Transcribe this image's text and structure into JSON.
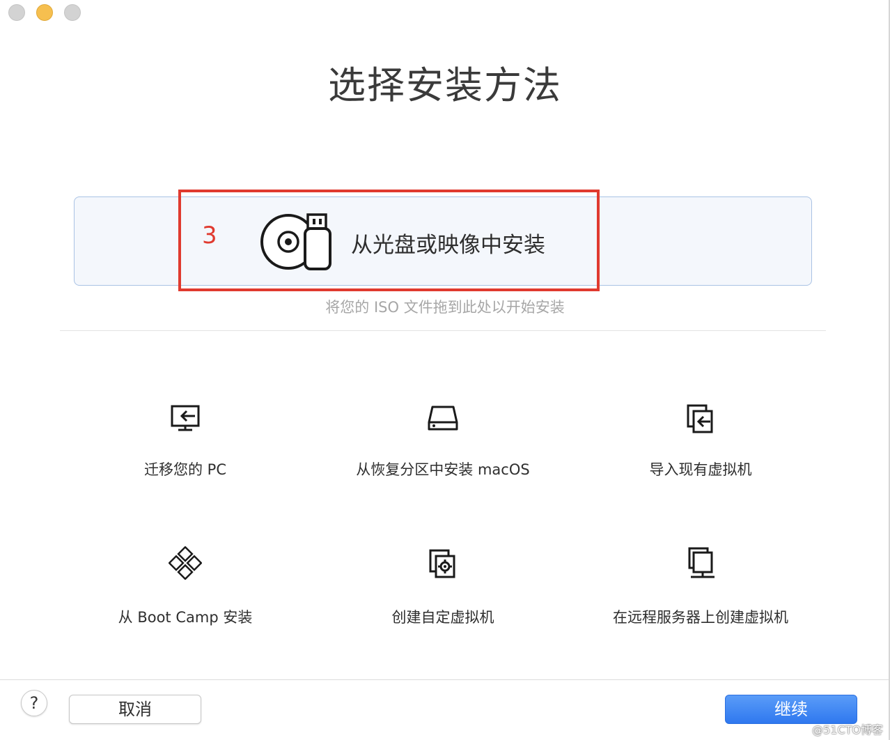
{
  "window": {
    "title": "选择安装方法"
  },
  "primary_option": {
    "step_number": "3",
    "label": "从光盘或映像中安装",
    "icon": "disc-usb-icon",
    "hint": "将您的 ISO 文件拖到此处以开始安装"
  },
  "options": [
    {
      "label": "迁移您的 PC",
      "icon": "monitor-import-icon"
    },
    {
      "label": "从恢复分区中安装 macOS",
      "icon": "drive-icon"
    },
    {
      "label": "导入现有虚拟机",
      "icon": "copy-import-icon"
    },
    {
      "label": "从 Boot Camp 安装",
      "icon": "bootcamp-diamond-icon"
    },
    {
      "label": "创建自定虚拟机",
      "icon": "custom-vm-icon"
    },
    {
      "label": "在远程服务器上创建虚拟机",
      "icon": "remote-server-icon"
    }
  ],
  "footer": {
    "help_label": "?",
    "cancel_label": "取消",
    "continue_label": "继续"
  },
  "watermark": "@51CTO博客",
  "colors": {
    "accent": "#2f78ef",
    "highlight": "#e03a2f",
    "card_border": "#a9c2e4"
  }
}
